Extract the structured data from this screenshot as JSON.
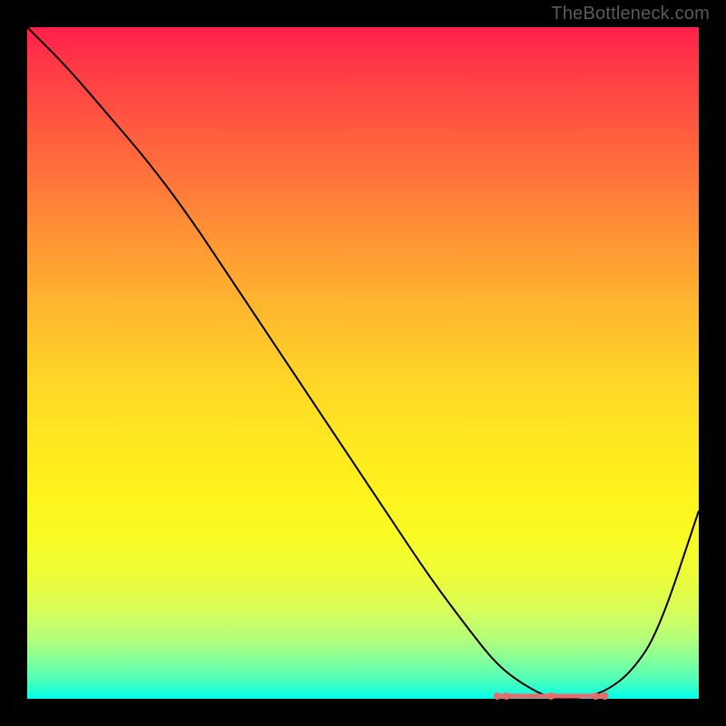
{
  "watermark": "TheBottleneck.com",
  "chart_data": {
    "type": "line",
    "title": "",
    "xlabel": "",
    "ylabel": "",
    "xlim": [
      0,
      100
    ],
    "ylim": [
      0,
      100
    ],
    "grid": false,
    "legend": false,
    "series": [
      {
        "name": "curve",
        "x": [
          0,
          6,
          12,
          18,
          24,
          30,
          36,
          42,
          48,
          54,
          60,
          66,
          70,
          74,
          78,
          82,
          86,
          90,
          94,
          100
        ],
        "values": [
          100,
          94,
          87,
          80,
          72,
          63,
          54,
          45,
          36,
          27,
          18,
          10,
          5,
          2,
          0,
          0,
          1,
          4,
          10,
          28
        ]
      }
    ],
    "highlight": {
      "x_range": [
        70,
        86
      ],
      "y": 0,
      "color": "#e86a6a"
    },
    "background_gradient": {
      "top": "#ff1f4a",
      "bottom": "#00fff0"
    }
  }
}
